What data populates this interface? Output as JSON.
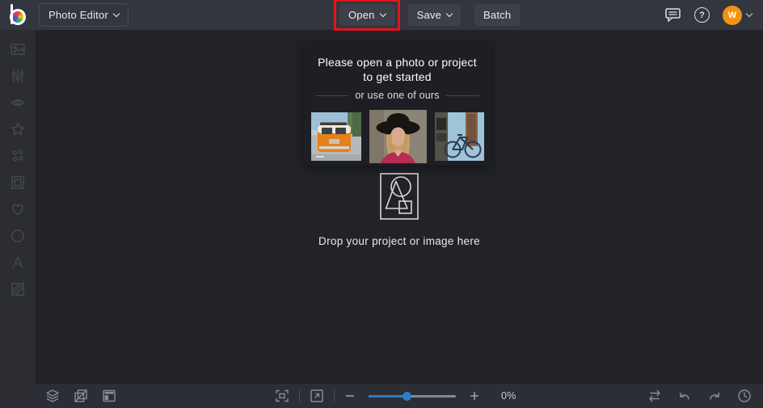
{
  "topbar": {
    "app_menu_label": "Photo Editor",
    "open_label": "Open",
    "save_label": "Save",
    "batch_label": "Batch",
    "help_glyph": "?",
    "avatar_initial": "W"
  },
  "sidebar": {
    "icons": [
      "image",
      "adjust-sliders",
      "eye",
      "star",
      "artsy-dots",
      "frame",
      "heart",
      "shape-blob",
      "text",
      "texture"
    ]
  },
  "popup": {
    "title": "Please open a photo or project to get started",
    "divider_label": "or use one of ours",
    "samples": [
      {
        "name": "orange-van-sample"
      },
      {
        "name": "portrait-woman-sample"
      },
      {
        "name": "blue-bicycle-sample"
      }
    ]
  },
  "dropzone": {
    "label": "Drop your project or image here"
  },
  "bottombar": {
    "zoom_level": "0%"
  },
  "colors": {
    "accent_blue": "#2e7cc4",
    "avatar_orange": "#f29413",
    "annotation_red": "#e0151b",
    "topbar_bg": "#33363d",
    "canvas_bg": "#212329",
    "popup_bg": "#1d1f25"
  }
}
